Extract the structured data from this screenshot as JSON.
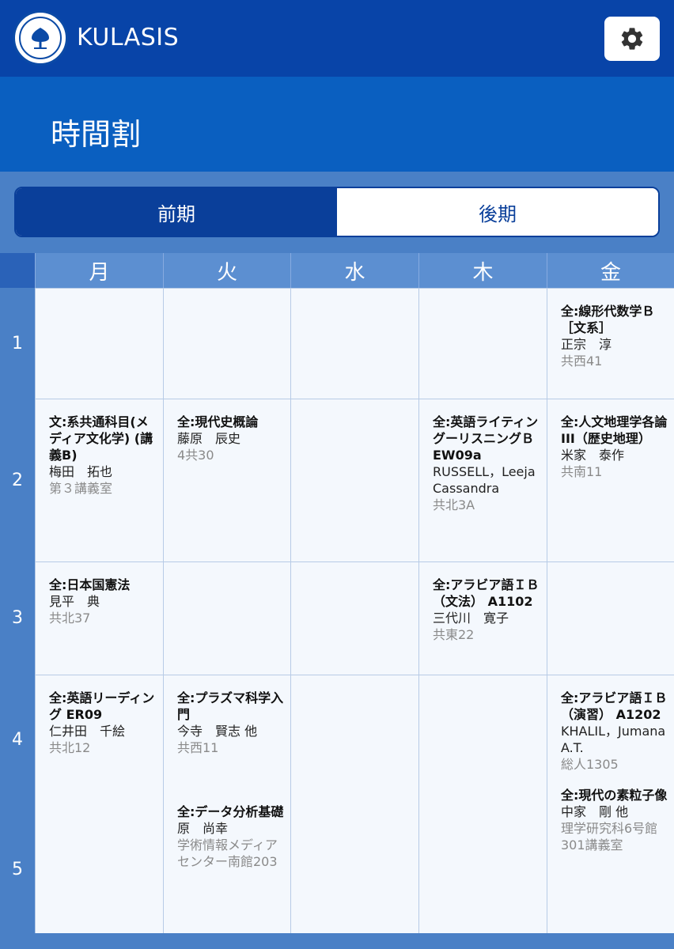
{
  "header": {
    "app_title": "KULASIS",
    "logo_icon": "kyoto-university-crest",
    "settings_icon": "gear-icon"
  },
  "page": {
    "title": "時間割"
  },
  "terms": [
    {
      "label": "前期",
      "selected": true
    },
    {
      "label": "後期",
      "selected": false
    }
  ],
  "days": [
    "月",
    "火",
    "水",
    "木",
    "金"
  ],
  "periods": [
    "1",
    "2",
    "3",
    "4",
    "5"
  ],
  "cells": {
    "p1_fri": [
      {
        "name": "全:線形代数学Ｂ［文系］",
        "teacher": "正宗　淳",
        "room": "共西41"
      }
    ],
    "p2_mon": [
      {
        "name": "文:系共通科目(メディア文化学) (講義B)",
        "teacher": "梅田　拓也",
        "room": "第３講義室"
      }
    ],
    "p2_tue": [
      {
        "name": "全:現代史概論",
        "teacher": "藤原　辰史",
        "room": "4共30"
      }
    ],
    "p2_thu": [
      {
        "name": "全:英語ライティングーリスニングＢ EW09a",
        "teacher": "RUSSELL，Leeja Cassandra",
        "room": "共北3A"
      }
    ],
    "p2_fri": [
      {
        "name": "全:人文地理学各論III（歴史地理）",
        "teacher": "米家　泰作",
        "room": "共南11"
      }
    ],
    "p3_mon": [
      {
        "name": "全:日本国憲法",
        "teacher": "見平　典",
        "room": "共北37"
      }
    ],
    "p3_thu": [
      {
        "name": "全:アラビア語ＩＢ（文法） A1102",
        "teacher": "三代川　寛子",
        "room": "共東22"
      }
    ],
    "p4_mon": [
      {
        "name": "全:英語リーディング ER09",
        "teacher": "仁井田　千絵",
        "room": "共北12"
      }
    ],
    "p4_tue": [
      {
        "name": "全:プラズマ科学入門",
        "teacher": "今寺　賢志 他",
        "room": "共西11"
      },
      {
        "name": "全:データ分析基礎",
        "teacher": "原　尚幸",
        "room": "学術情報メディアセンター南館203"
      }
    ],
    "p4_fri": [
      {
        "name": "全:アラビア語ＩＢ（演習） A1202",
        "teacher": "KHALIL，Jumana A.T.",
        "room": "総人1305"
      },
      {
        "name": "全:現代の素粒子像",
        "teacher": "中家　剛 他",
        "room": "理学研究科6号館301講義室"
      }
    ]
  },
  "colors": {
    "header_bg": "#0844a8",
    "title_band_bg": "#0a5fc0",
    "grid_bg": "#4a80c6",
    "cell_bg": "#f4f8fd",
    "accent": "#0a3f9a"
  }
}
